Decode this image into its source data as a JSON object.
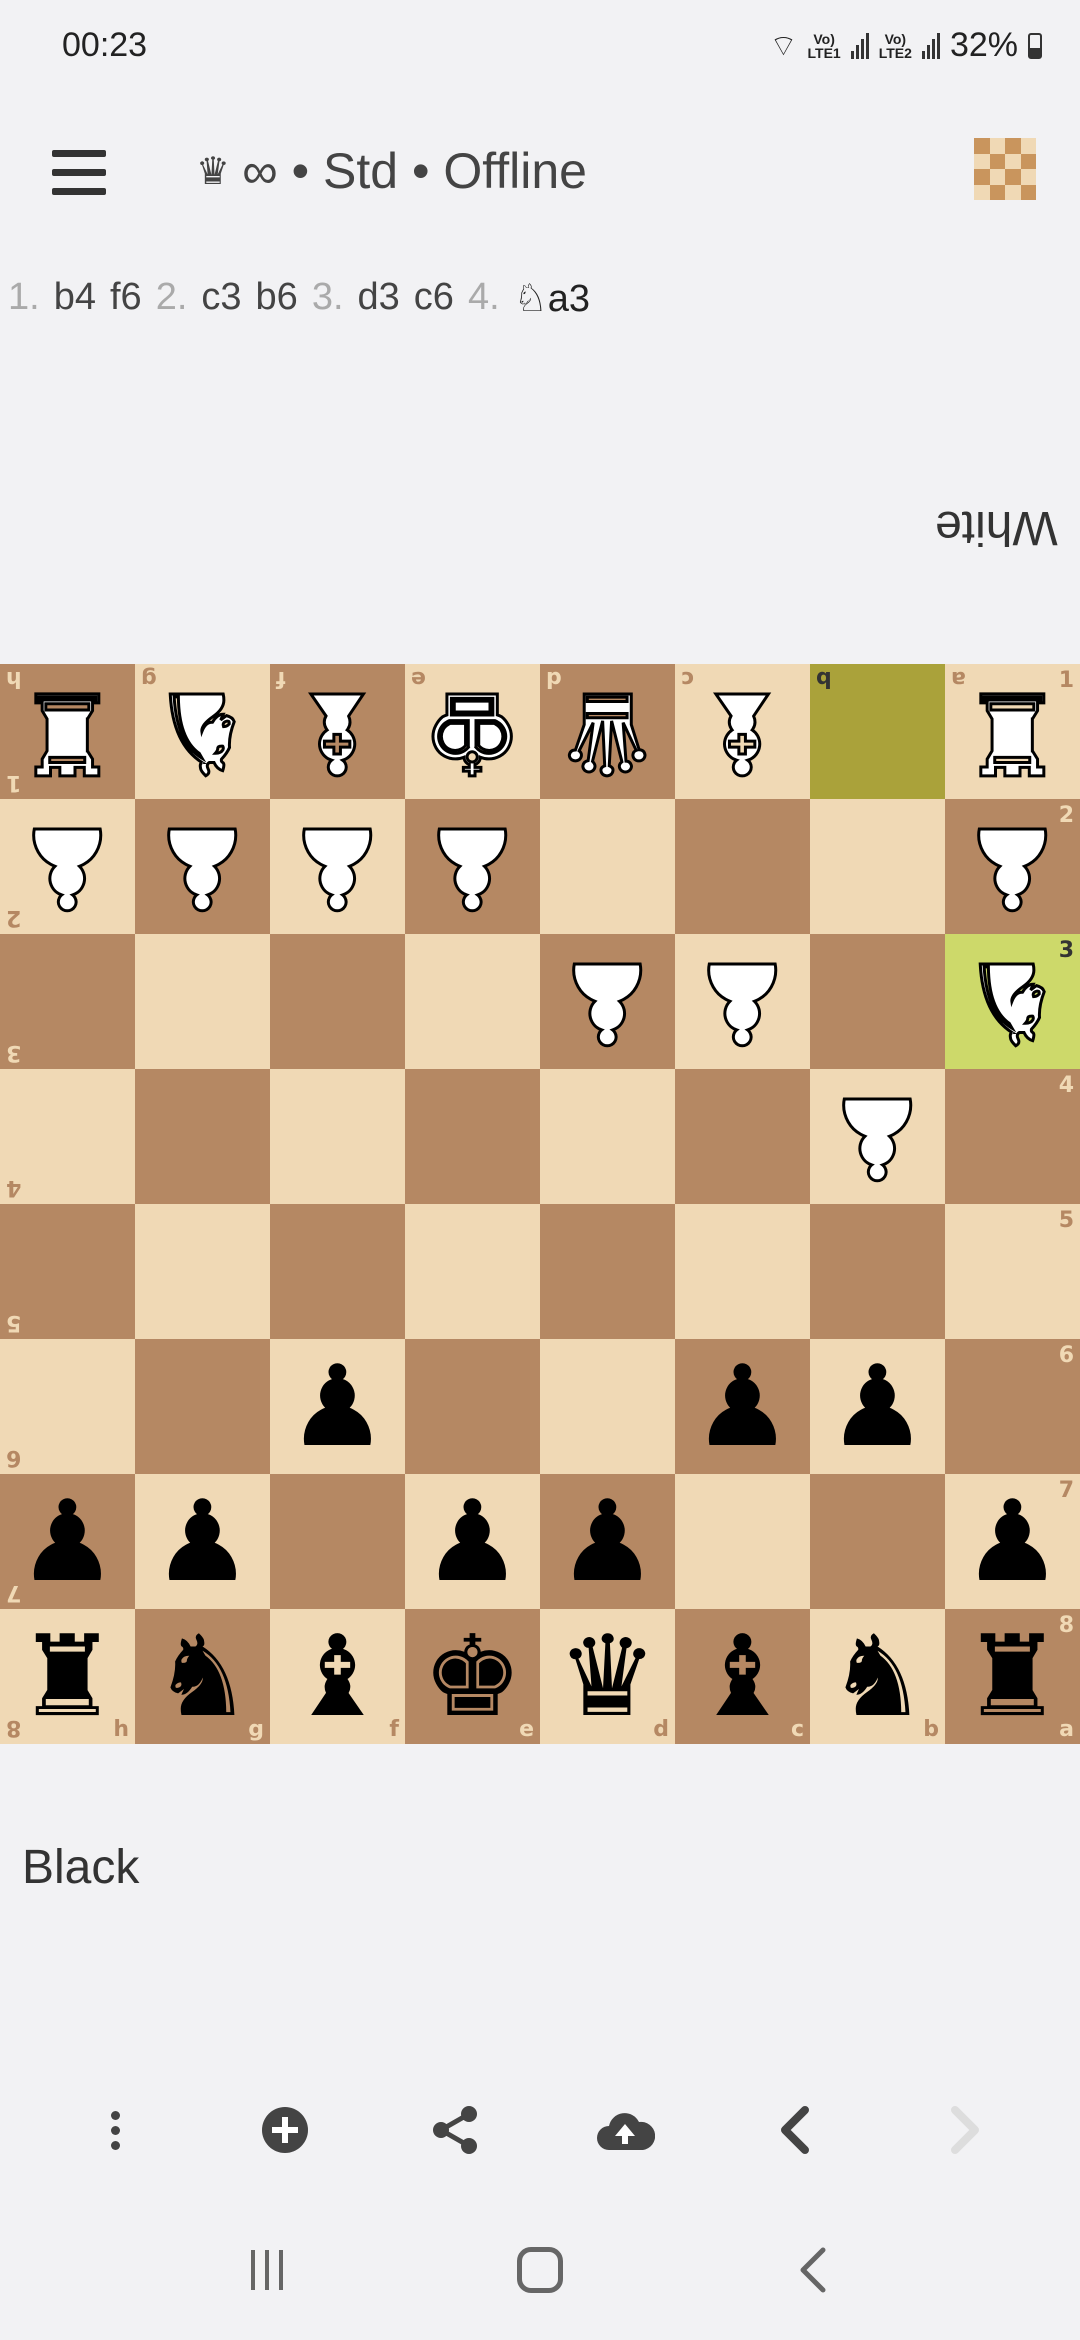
{
  "status": {
    "time": "00:23",
    "lte1": "LTE1",
    "lte2": "LTE2",
    "battery": "32%"
  },
  "toolbar": {
    "title": "∞ • Std • Offline",
    "menu_icon": "hamburger-icon",
    "mode_icon": "crown-icon",
    "board_icon": "chessboard-icon"
  },
  "moves": [
    {
      "num": "1.",
      "white": "b4",
      "black": "f6"
    },
    {
      "num": "2.",
      "white": "c3",
      "black": "b6"
    },
    {
      "num": "3.",
      "white": "d3",
      "black": "c6"
    },
    {
      "num": "4.",
      "white": "♘a3",
      "black": ""
    }
  ],
  "players": {
    "top": "White",
    "bottom": "Black"
  },
  "board": {
    "orientation": "black-bottom",
    "last_move_from": "b1",
    "last_move_to": "a3",
    "position": {
      "a1": "wR",
      "c1": "wB",
      "d1": "wQ",
      "e1": "wK",
      "f1": "wB",
      "g1": "wN",
      "h1": "wR",
      "a2": "wP",
      "e2": "wP",
      "f2": "wP",
      "g2": "wP",
      "h2": "wP",
      "a3": "wN",
      "c3": "wP",
      "d3": "wP",
      "b4": "wP",
      "b6": "bP",
      "c6": "bP",
      "f6": "bP",
      "a7": "bP",
      "d7": "bP",
      "e7": "bP",
      "g7": "bP",
      "h7": "bP",
      "a8": "bR",
      "b8": "bN",
      "c8": "bB",
      "d8": "bQ",
      "e8": "bK",
      "f8": "bB",
      "g8": "bN",
      "h8": "bR"
    }
  },
  "bottom_bar": [
    "more-vertical-icon",
    "add-circle-icon",
    "share-icon",
    "cloud-upload-icon",
    "chevron-left-icon",
    "chevron-right-icon"
  ],
  "colors": {
    "light_square": "#f0d9b5",
    "dark_square": "#b58863",
    "highlight_light": "#cdd96a",
    "highlight_dark": "#aaa23a"
  }
}
